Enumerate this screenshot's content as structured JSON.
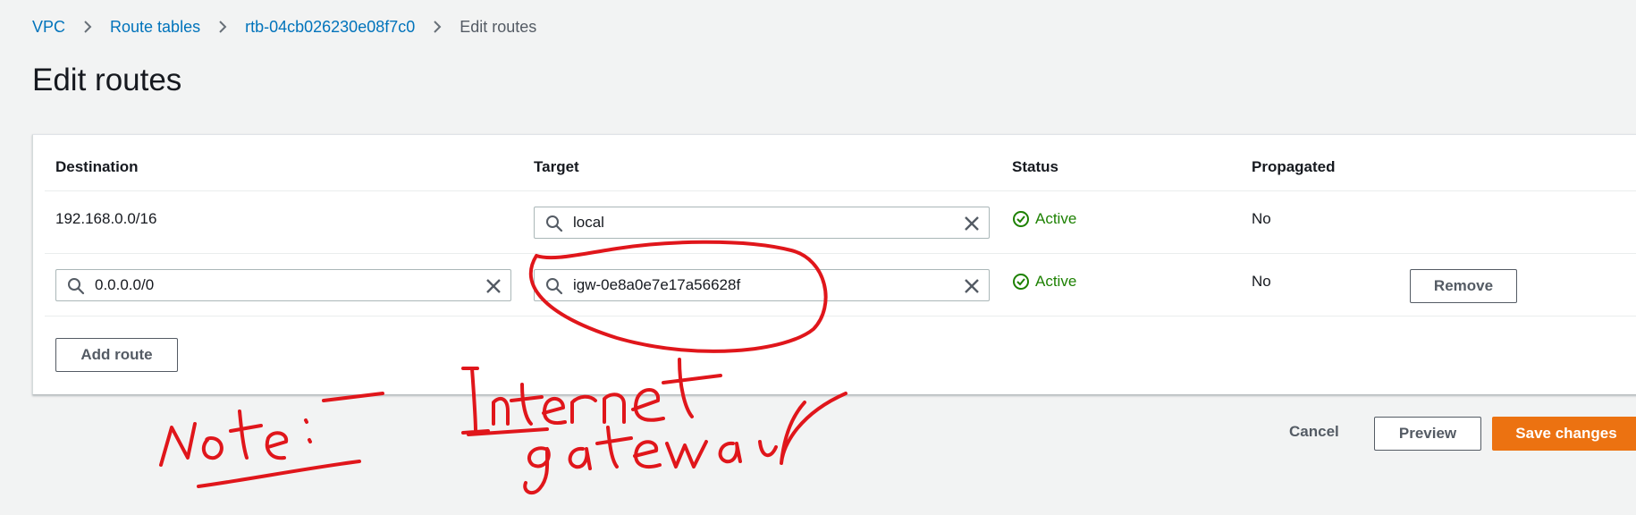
{
  "breadcrumb": {
    "items": [
      {
        "label": "VPC"
      },
      {
        "label": "Route tables"
      },
      {
        "label": "rtb-04cb026230e08f7c0"
      }
    ],
    "current": "Edit routes"
  },
  "page": {
    "title": "Edit routes"
  },
  "table": {
    "columns": [
      "Destination",
      "Target",
      "Status",
      "Propagated"
    ],
    "rows": [
      {
        "destination": "192.168.0.0/16",
        "target": "local",
        "status": "Active",
        "propagated": "No"
      },
      {
        "destination": "0.0.0.0/0",
        "target": "igw-0e8a0e7e17a56628f",
        "status": "Active",
        "propagated": "No",
        "remove_label": "Remove"
      }
    ]
  },
  "actions": {
    "add_route": "Add route",
    "cancel": "Cancel",
    "preview": "Preview",
    "save": "Save changes"
  },
  "colors": {
    "link": "#0073bb",
    "status_active": "#1d8102",
    "primary_button": "#ec7211",
    "annotation_ink": "#e0161b"
  },
  "icons": {
    "search": "search-icon",
    "clear": "close-icon",
    "status": "status-positive-icon",
    "separator": "chevron-right-icon"
  }
}
